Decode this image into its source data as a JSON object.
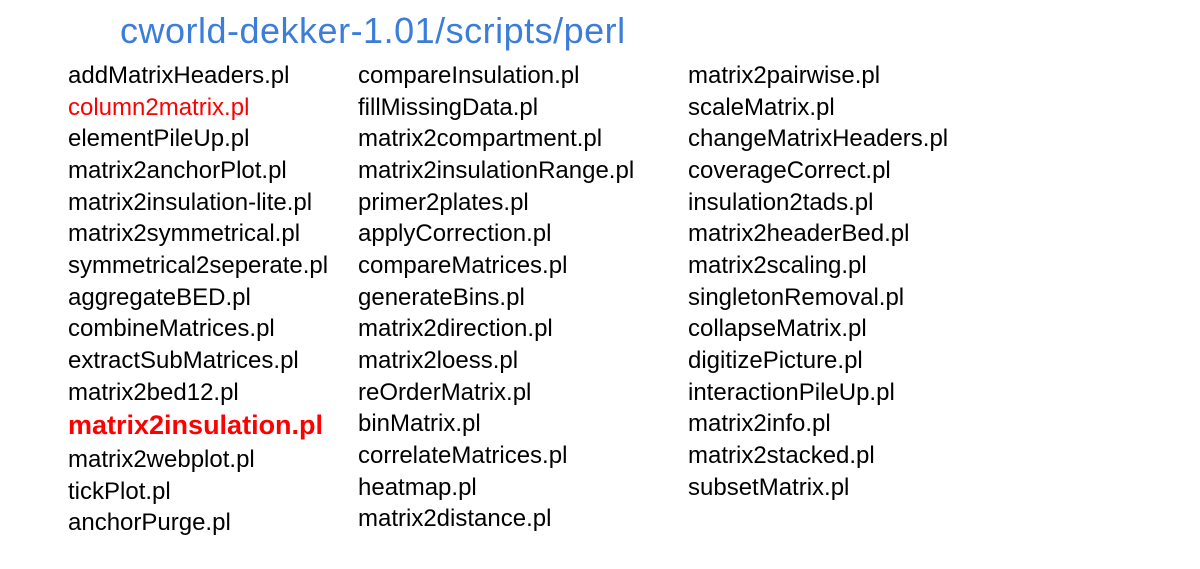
{
  "title": "cworld-dekker-1.01/scripts/perl",
  "columns": {
    "col1": [
      {
        "text": "addMatrixHeaders.pl",
        "style": "normal"
      },
      {
        "text": "column2matrix.pl",
        "style": "highlight"
      },
      {
        "text": "elementPileUp.pl",
        "style": "normal"
      },
      {
        "text": "matrix2anchorPlot.pl",
        "style": "normal"
      },
      {
        "text": "matrix2insulation-lite.pl",
        "style": "normal"
      },
      {
        "text": "matrix2symmetrical.pl",
        "style": "normal"
      },
      {
        "text": "symmetrical2seperate.pl",
        "style": "normal"
      },
      {
        "text": "aggregateBED.pl",
        "style": "normal"
      },
      {
        "text": "combineMatrices.pl",
        "style": "normal"
      },
      {
        "text": "extractSubMatrices.pl",
        "style": "normal"
      },
      {
        "text": "matrix2bed12.pl",
        "style": "normal"
      },
      {
        "text": "matrix2insulation.pl",
        "style": "highlight-bold"
      },
      {
        "text": "matrix2webplot.pl",
        "style": "normal"
      },
      {
        "text": "tickPlot.pl",
        "style": "normal"
      },
      {
        "text": "anchorPurge.pl",
        "style": "normal"
      }
    ],
    "col2": [
      {
        "text": "compareInsulation.pl",
        "style": "normal"
      },
      {
        "text": "fillMissingData.pl",
        "style": "normal"
      },
      {
        "text": "matrix2compartment.pl",
        "style": "normal"
      },
      {
        "text": "matrix2insulationRange.pl",
        "style": "normal"
      },
      {
        "text": "primer2plates.pl",
        "style": "normal"
      },
      {
        "text": "applyCorrection.pl",
        "style": "normal"
      },
      {
        "text": "compareMatrices.pl",
        "style": "normal"
      },
      {
        "text": "generateBins.pl",
        "style": "normal"
      },
      {
        "text": "matrix2direction.pl",
        "style": "normal"
      },
      {
        "text": "matrix2loess.pl",
        "style": "normal"
      },
      {
        "text": "reOrderMatrix.pl",
        "style": "normal"
      },
      {
        "text": "binMatrix.pl",
        "style": "normal"
      },
      {
        "text": "correlateMatrices.pl",
        "style": "normal"
      },
      {
        "text": "heatmap.pl",
        "style": "normal"
      },
      {
        "text": "matrix2distance.pl",
        "style": "normal"
      }
    ],
    "col3": [
      {
        "text": "matrix2pairwise.pl",
        "style": "normal"
      },
      {
        "text": "scaleMatrix.pl",
        "style": "normal"
      },
      {
        "text": "changeMatrixHeaders.pl",
        "style": "normal"
      },
      {
        "text": "coverageCorrect.pl",
        "style": "normal"
      },
      {
        "text": "insulation2tads.pl",
        "style": "normal"
      },
      {
        "text": "matrix2headerBed.pl",
        "style": "normal"
      },
      {
        "text": "matrix2scaling.pl",
        "style": "normal"
      },
      {
        "text": "singletonRemoval.pl",
        "style": "normal"
      },
      {
        "text": "collapseMatrix.pl",
        "style": "normal"
      },
      {
        "text": "digitizePicture.pl",
        "style": "normal"
      },
      {
        "text": "interactionPileUp.pl",
        "style": "normal"
      },
      {
        "text": "matrix2info.pl",
        "style": "normal"
      },
      {
        "text": "matrix2stacked.pl",
        "style": "normal"
      },
      {
        "text": "subsetMatrix.pl",
        "style": "normal"
      }
    ]
  }
}
